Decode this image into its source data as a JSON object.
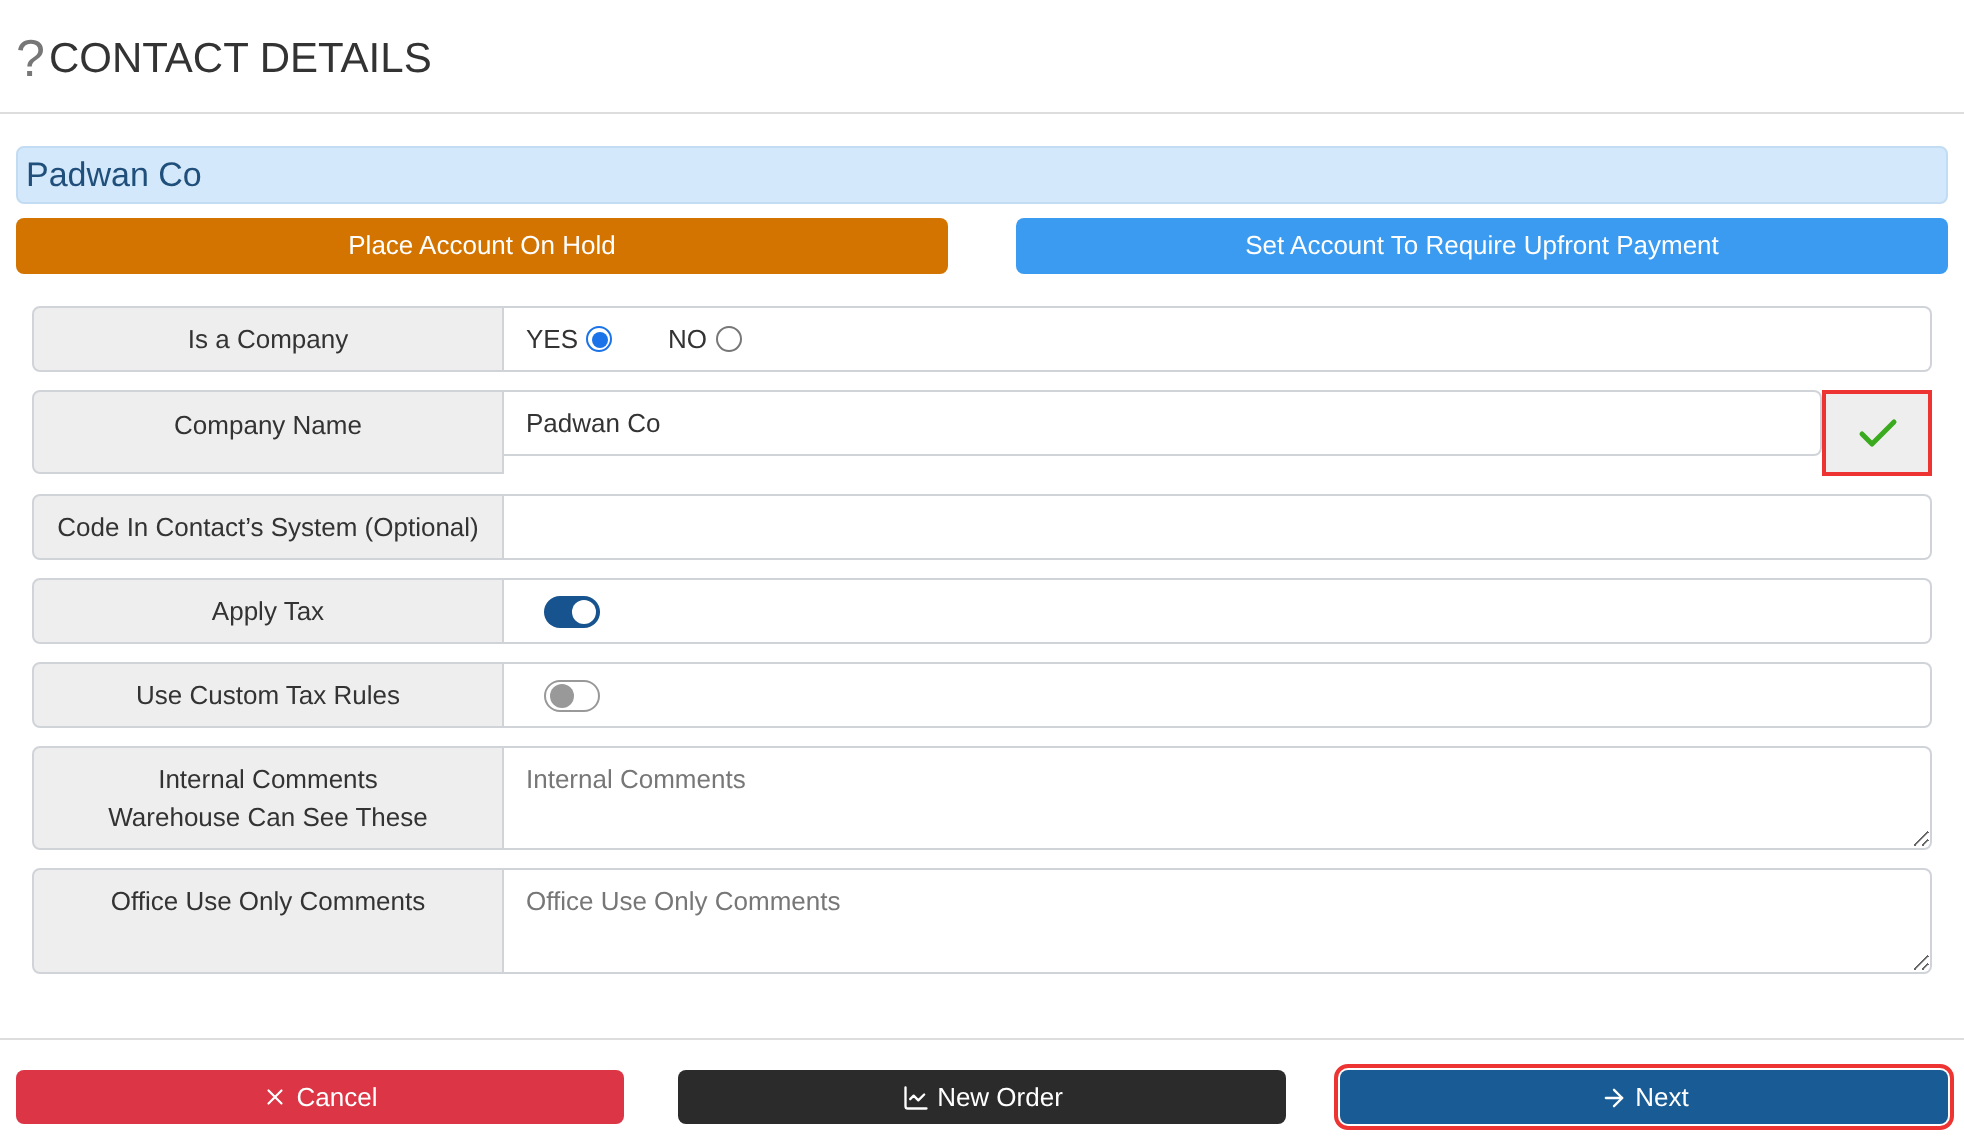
{
  "header": {
    "glyph": "?",
    "title": "CONTACT DETAILS"
  },
  "name_banner": "Padwan Co",
  "account_buttons": [
    {
      "label": "Place Account On Hold",
      "kind": "hold"
    },
    {
      "label": "Set Account To Require Upfront Payment",
      "kind": "upfront"
    }
  ],
  "fields": [
    {
      "kind": "radio",
      "label": "Is a Company",
      "options": [
        {
          "label": "YES",
          "selected": true
        },
        {
          "label": "NO",
          "selected": false
        }
      ]
    },
    {
      "kind": "text",
      "label": "Company Name",
      "value": "Padwan Co",
      "confirm": {
        "highlighted": true
      }
    },
    {
      "kind": "text",
      "label": "Code In Contact’s System (Optional)"
    },
    {
      "kind": "toggle",
      "label": "Apply Tax",
      "on": true
    },
    {
      "kind": "toggle",
      "label": "Use Custom Tax Rules",
      "on": false
    },
    {
      "kind": "textarea",
      "label": "Internal Comments\nWarehouse Can See These",
      "placeholder": "Internal Comments"
    },
    {
      "kind": "textarea",
      "label": "Office Use Only Comments",
      "placeholder": "Office Use Only Comments"
    }
  ],
  "footer_buttons": [
    {
      "label": "Cancel",
      "kind": "cancel",
      "highlighted": false
    },
    {
      "label": "New Order",
      "kind": "order",
      "highlighted": false
    },
    {
      "label": "Next",
      "kind": "next",
      "highlighted": true
    }
  ]
}
